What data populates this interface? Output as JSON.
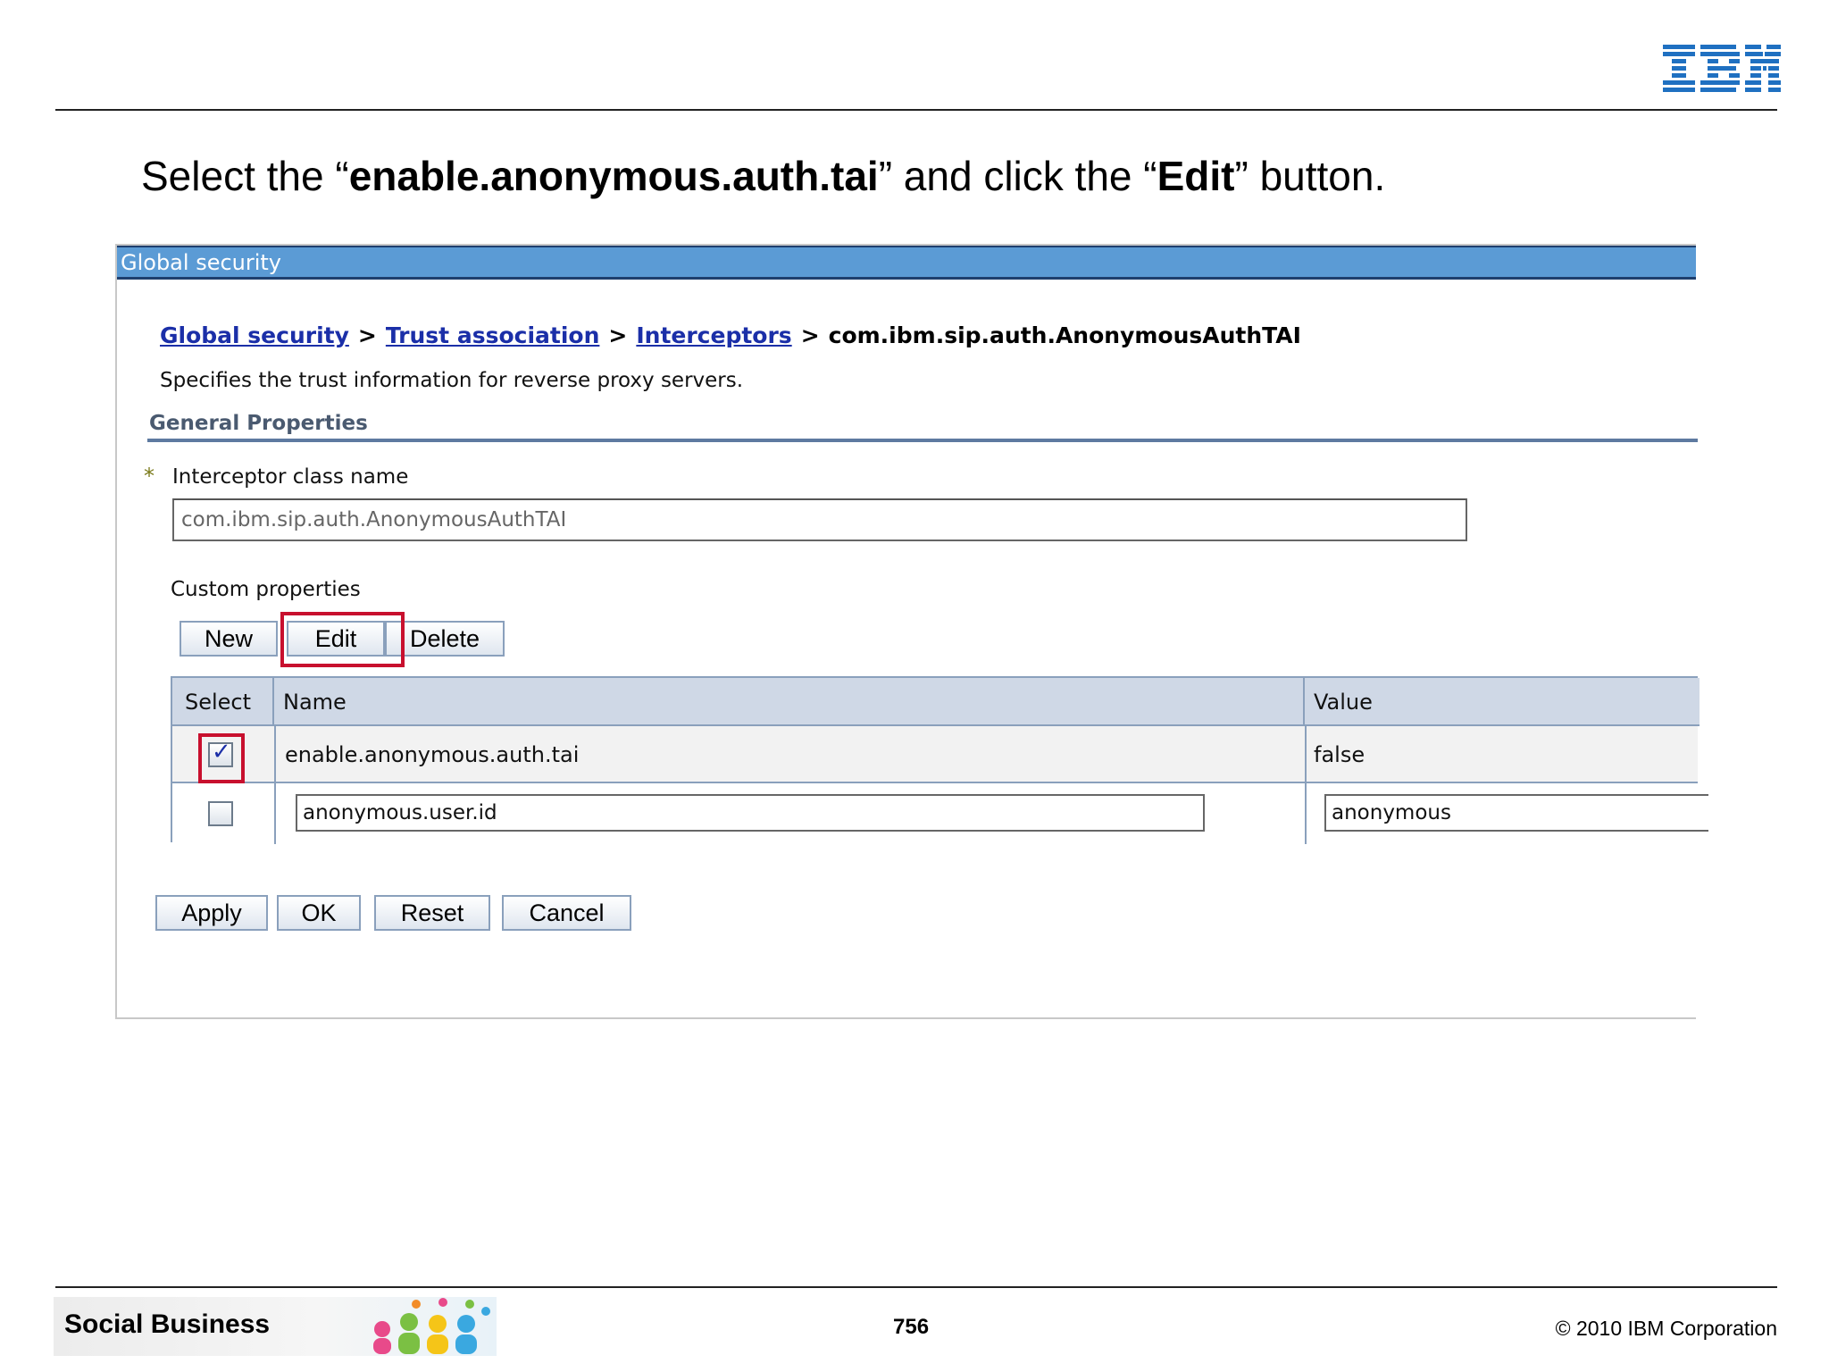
{
  "slide": {
    "logo_text": "IBM",
    "instruction": {
      "part1": "Select the “",
      "bold1": "enable.anonymous.auth.tai",
      "part2": "” and click the “",
      "bold2": "Edit",
      "part3": "” button."
    },
    "footer": {
      "banner_label": "Social Business",
      "page_number": "756",
      "copyright": "© 2010 IBM Corporation"
    }
  },
  "console": {
    "header_title": "Global security",
    "breadcrumb": {
      "link1": "Global security",
      "link2": "Trust association",
      "link3": "Interceptors",
      "separator": ">",
      "current": "com.ibm.sip.auth.AnonymousAuthTAI"
    },
    "description": "Specifies the trust information for reverse proxy servers.",
    "section_title": "General Properties",
    "required_marker": "*",
    "interceptor_label": "Interceptor class name",
    "interceptor_value": "com.ibm.sip.auth.AnonymousAuthTAI",
    "custom_properties_label": "Custom properties",
    "table_buttons": {
      "new": "New",
      "edit": "Edit",
      "delete": "Delete"
    },
    "table": {
      "headers": {
        "select": "Select",
        "name": "Name",
        "value": "Value"
      },
      "rows": [
        {
          "checked": true,
          "name": "enable.anonymous.auth.tai",
          "value": "false"
        },
        {
          "checked": false,
          "name": "anonymous.user.id",
          "value": "anonymous"
        }
      ]
    },
    "form_buttons": {
      "apply": "Apply",
      "ok": "OK",
      "reset": "Reset",
      "cancel": "Cancel"
    }
  },
  "colors": {
    "header_bar": "#5b9bd5",
    "link": "#1b2fa8",
    "highlight": "#c8102e",
    "ibm_blue": "#1f70c1"
  },
  "icons": {
    "checkmark": "✓"
  }
}
